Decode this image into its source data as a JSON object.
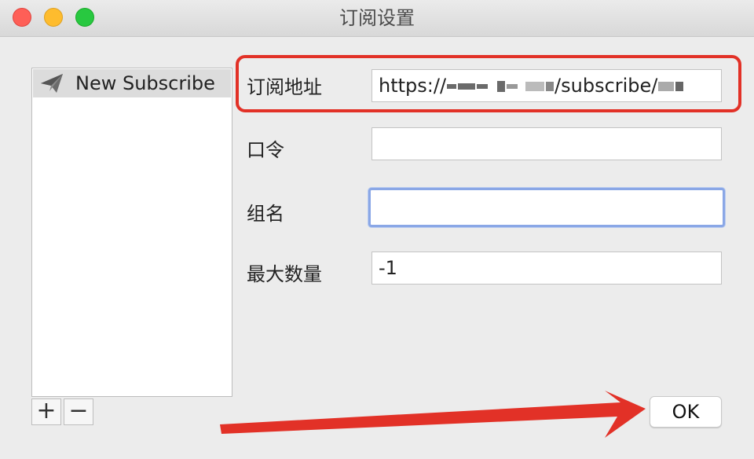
{
  "window": {
    "title": "订阅设置"
  },
  "subscriptions": {
    "items": [
      {
        "label": "New Subscribe",
        "icon": "paper-plane-icon"
      }
    ],
    "add_label": "+",
    "remove_label": "−"
  },
  "form": {
    "url_label": "订阅地址",
    "url_value_prefix": "https://",
    "url_value_middle": "/subscribe/",
    "password_label": "口令",
    "password_value": "",
    "group_label": "组名",
    "group_value": "",
    "max_label": "最大数量",
    "max_value": "-1"
  },
  "actions": {
    "ok_label": "OK"
  },
  "colors": {
    "annotation_red": "#e23127",
    "focus_blue": "#8aa7e6"
  }
}
